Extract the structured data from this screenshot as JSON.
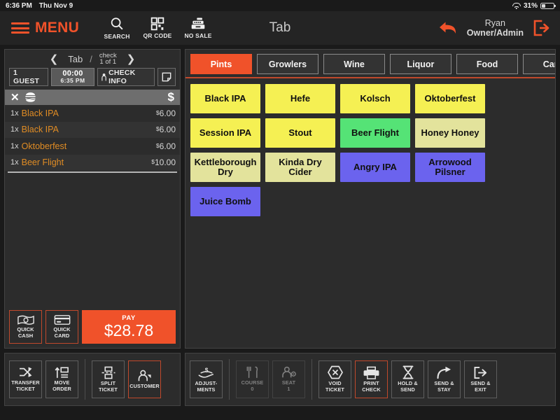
{
  "statusbar": {
    "time": "6:36 PM",
    "date": "Thu Nov 9",
    "battery_pct": "31%",
    "wifi_icon": "wifi-icon",
    "battery_icon": "battery-icon"
  },
  "topnav": {
    "menu_label": "MENU",
    "title": "Tab",
    "icons": [
      {
        "label": "SEARCH",
        "icon": "search-icon"
      },
      {
        "label": "QR CODE",
        "icon": "qr-code-icon"
      },
      {
        "label": "NO SALE",
        "icon": "cash-register-icon"
      }
    ],
    "back_icon": "back-arrow-icon",
    "logout_icon": "logout-icon",
    "user_name": "Ryan",
    "user_role": "Owner/Admin"
  },
  "order": {
    "prev_icon": "chevron-left-icon",
    "next_icon": "chevron-right-icon",
    "tab_label": "Tab",
    "separator": "/",
    "check_label": "check",
    "check_count": "1 of 1",
    "guest_label": "1 GUEST",
    "timer_elapsed": "00:00",
    "timer_clock": "6:35 PM",
    "check_info_label": "CHECK INFO",
    "check_info_icon": "person-icon",
    "note_icon": "note-icon",
    "toolbar": {
      "close_icon": "close-x-icon",
      "food_icon": "burger-icon",
      "dollar_icon": "dollar-sign-icon"
    },
    "items": [
      {
        "qty": "1x",
        "name": "Black IPA",
        "currency": "$",
        "price": "6.00"
      },
      {
        "qty": "1x",
        "name": "Black IPA",
        "currency": "$",
        "price": "6.00"
      },
      {
        "qty": "1x",
        "name": "Oktoberfest",
        "currency": "$",
        "price": "6.00"
      },
      {
        "qty": "1x",
        "name": "Beer Flight",
        "currency": "$",
        "price": "10.00"
      }
    ],
    "quick_cash": {
      "line1": "QUICK",
      "line2": "CASH",
      "icon": "cash-icon"
    },
    "quick_card": {
      "line1": "QUICK",
      "line2": "CARD",
      "icon": "credit-card-icon"
    },
    "pay": {
      "label": "PAY",
      "amount": "$28.78"
    }
  },
  "products": {
    "tabs": [
      {
        "label": "Pints",
        "active": true
      },
      {
        "label": "Growlers",
        "active": false
      },
      {
        "label": "Wine",
        "active": false
      },
      {
        "label": "Liquor",
        "active": false
      },
      {
        "label": "Food",
        "active": false
      },
      {
        "label": "Cans",
        "active": false
      }
    ],
    "colors": {
      "beer_yellow": "#f5f053",
      "flight_green": "#55e376",
      "cider_khaki": "#e3e39c",
      "ipa_purple": "#6b63ee",
      "accent_orange": "#f0522a"
    },
    "tiles": [
      {
        "label": "Black IPA",
        "color": "#f5f053"
      },
      {
        "label": "Hefe",
        "color": "#f5f053"
      },
      {
        "label": "Kolsch",
        "color": "#f5f053"
      },
      {
        "label": "Oktoberfest",
        "color": "#f5f053"
      },
      {
        "label": "Session IPA",
        "color": "#f5f053"
      },
      {
        "label": "Stout",
        "color": "#f5f053"
      },
      {
        "label": "Beer Flight",
        "color": "#55e376"
      },
      {
        "label": "Honey Honey",
        "color": "#e3e39c"
      },
      {
        "label": "Kettleborough Dry",
        "color": "#e3e39c"
      },
      {
        "label": "Kinda Dry Cider",
        "color": "#e3e39c"
      },
      {
        "label": "Angry IPA",
        "color": "#6b63ee"
      },
      {
        "label": "Arrowood Pilsner",
        "color": "#6b63ee"
      },
      {
        "label": "Juice Bomb",
        "color": "#6b63ee"
      }
    ]
  },
  "bottom_left": [
    {
      "line1": "TRANSFER",
      "line2": "TICKET",
      "icon": "transfer-icon",
      "selected": false,
      "dim": false
    },
    {
      "line1": "MOVE",
      "line2": "ORDER",
      "icon": "move-order-icon",
      "selected": false,
      "dim": false
    },
    {
      "line1": "SPLIT",
      "line2": "TICKET",
      "icon": "split-ticket-icon",
      "selected": false,
      "dim": false
    },
    {
      "line1": "CUSTOMER",
      "line2": "",
      "icon": "customer-icon",
      "selected": true,
      "dim": false
    }
  ],
  "bottom_right": [
    {
      "line1": "ADJUST-",
      "line2": "MENTS",
      "icon": "adjustments-icon",
      "selected": false,
      "dim": false
    },
    {
      "line1": "COURSE",
      "line2": "0",
      "icon": "course-icon",
      "selected": false,
      "dim": true
    },
    {
      "line1": "SEAT",
      "line2": "1",
      "icon": "seat-icon",
      "selected": false,
      "dim": true
    },
    {
      "line1": "VOID",
      "line2": "TICKET",
      "icon": "void-icon",
      "selected": false,
      "dim": false
    },
    {
      "line1": "PRINT",
      "line2": "CHECK",
      "icon": "printer-icon",
      "selected": true,
      "dim": false
    },
    {
      "line1": "HOLD &",
      "line2": "SEND",
      "icon": "hourglass-icon",
      "selected": false,
      "dim": false
    },
    {
      "line1": "SEND &",
      "line2": "STAY",
      "icon": "send-stay-icon",
      "selected": false,
      "dim": false
    },
    {
      "line1": "SEND &",
      "line2": "EXIT",
      "icon": "send-exit-icon",
      "selected": false,
      "dim": false
    }
  ]
}
